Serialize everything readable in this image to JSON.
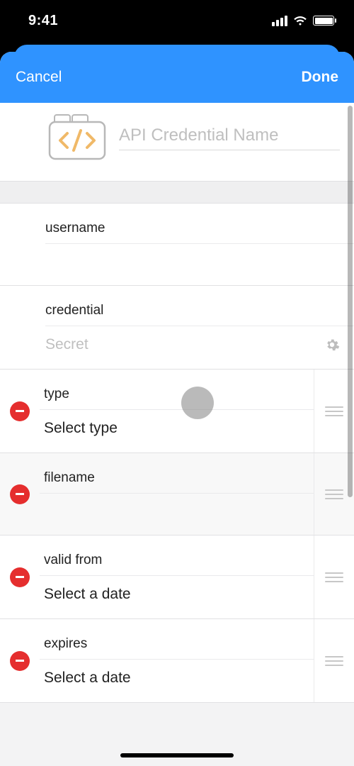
{
  "status": {
    "time": "9:41"
  },
  "header": {
    "cancel": "Cancel",
    "done": "Done"
  },
  "name_field": {
    "placeholder": "API Credential Name",
    "value": ""
  },
  "sections": {
    "username": {
      "label": "username",
      "value": ""
    },
    "credential": {
      "label": "credential",
      "placeholder": "Secret",
      "value": ""
    }
  },
  "rows": [
    {
      "key": "type",
      "label": "type",
      "value": "Select type",
      "value_is_placeholder": false
    },
    {
      "key": "filename",
      "label": "filename",
      "value": "",
      "value_is_placeholder": false
    },
    {
      "key": "valid_from",
      "label": "valid from",
      "value": "Select a date",
      "value_is_placeholder": false
    },
    {
      "key": "expires",
      "label": "expires",
      "value": "Select a date",
      "value_is_placeholder": false
    }
  ],
  "icons": {
    "folder": "api-folder-icon",
    "gear": "gear-icon",
    "signal": "signal-icon",
    "wifi": "wifi-icon",
    "battery": "battery-icon",
    "delete": "delete-minus-icon",
    "drag": "drag-handle-icon"
  }
}
